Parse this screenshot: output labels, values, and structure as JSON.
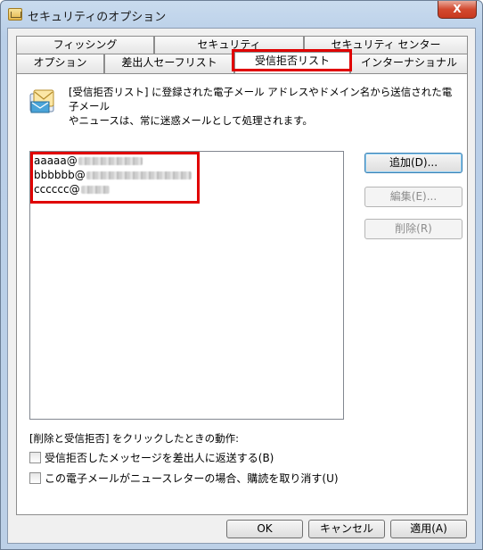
{
  "window": {
    "title": "セキュリティのオプション",
    "close_label": "X"
  },
  "tabs": {
    "row_back": [
      "フィッシング",
      "セキュリティ",
      "セキュリティ センター"
    ],
    "row_front": [
      "オプション",
      "差出人セーフリスト",
      "受信拒否リスト",
      "インターナショナル"
    ],
    "active": "受信拒否リスト"
  },
  "panel": {
    "icon": "envelope-list-icon",
    "description_line1": "[受信拒否リスト] に登録された電子メール アドレスやドメイン名から送信された電子メール",
    "description_line2": "やニュースは、常に迷惑メールとして処理されます。",
    "list": {
      "items": [
        {
          "visible": "aaaaa@",
          "redacted": true
        },
        {
          "visible": "bbbbbb@",
          "redacted": true
        },
        {
          "visible": "cccccc@",
          "redacted": true
        }
      ]
    },
    "buttons": {
      "add": "追加(D)...",
      "edit": "編集(E)...",
      "remove": "削除(R)"
    },
    "delete_action_label": "[削除と受信拒否] をクリックしたときの動作:",
    "options": [
      {
        "label": "受信拒否したメッセージを差出人に返送する(B)",
        "checked": false
      },
      {
        "label": "この電子メールがニュースレターの場合、購読を取り消す(U)",
        "checked": false
      }
    ]
  },
  "footer": {
    "ok": "OK",
    "cancel": "キャンセル",
    "apply": "適用(A)"
  },
  "colors": {
    "highlight": "#e00000",
    "title_bg": "#c9dbee"
  }
}
